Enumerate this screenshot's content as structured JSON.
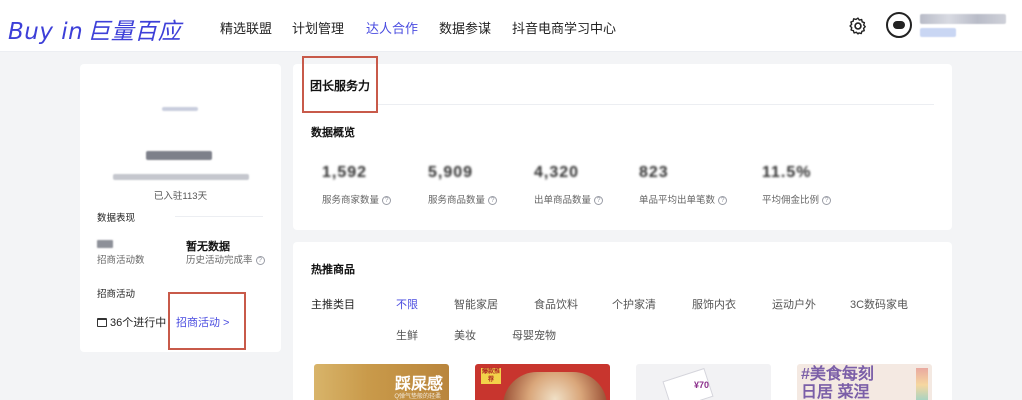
{
  "header": {
    "logo_text": "Buy in",
    "logo_cn": "巨量百应",
    "nav": [
      {
        "label": "精选联盟",
        "active": false
      },
      {
        "label": "计划管理",
        "active": false
      },
      {
        "label": "达人合作",
        "active": true
      },
      {
        "label": "数据参谋",
        "active": false
      },
      {
        "label": "抖音电商学习中心",
        "active": false
      }
    ]
  },
  "profile": {
    "settled_days": "已入驻113天",
    "data_section_label": "数据表现",
    "stats": [
      {
        "value": "",
        "label": "招商活动数"
      },
      {
        "value": "暂无数据",
        "label": "历史活动完成率"
      }
    ],
    "activity_section_label": "招商活动",
    "ongoing_text": "36个进行中",
    "activity_link": "招商活动 >"
  },
  "service": {
    "title": "团长服务力",
    "overview_label": "数据概览",
    "metrics": [
      {
        "value": "1,592",
        "label": "服务商家数量"
      },
      {
        "value": "5,909",
        "label": "服务商品数量"
      },
      {
        "value": "4,320",
        "label": "出单商品数量"
      },
      {
        "value": "823",
        "label": "单品平均出单笔数"
      },
      {
        "value": "11.5%",
        "label": "平均佣金比例"
      }
    ]
  },
  "hot": {
    "title": "热推商品",
    "category_label": "主推类目",
    "categories": [
      "不限",
      "智能家居",
      "食品饮料",
      "个护家清",
      "服饰内衣",
      "运动户外",
      "3C数码家电",
      "生鲜",
      "美妆",
      "母婴宠物"
    ],
    "thumb1_text": "踩屎感",
    "thumb1_sub": "Q弹气垫般的轻柔",
    "thumb2_badge": "爆款推荐",
    "thumb3_text": "¥70",
    "thumb4_line1": "#美食每刻",
    "thumb4_line2": "日居 菜涅"
  },
  "colors": {
    "accent": "#4a4ce0",
    "highlight_box": "#c85a4a"
  },
  "icons": {
    "settings": "gear-icon",
    "help": "help-circle-icon",
    "calendar": "calendar-icon"
  }
}
